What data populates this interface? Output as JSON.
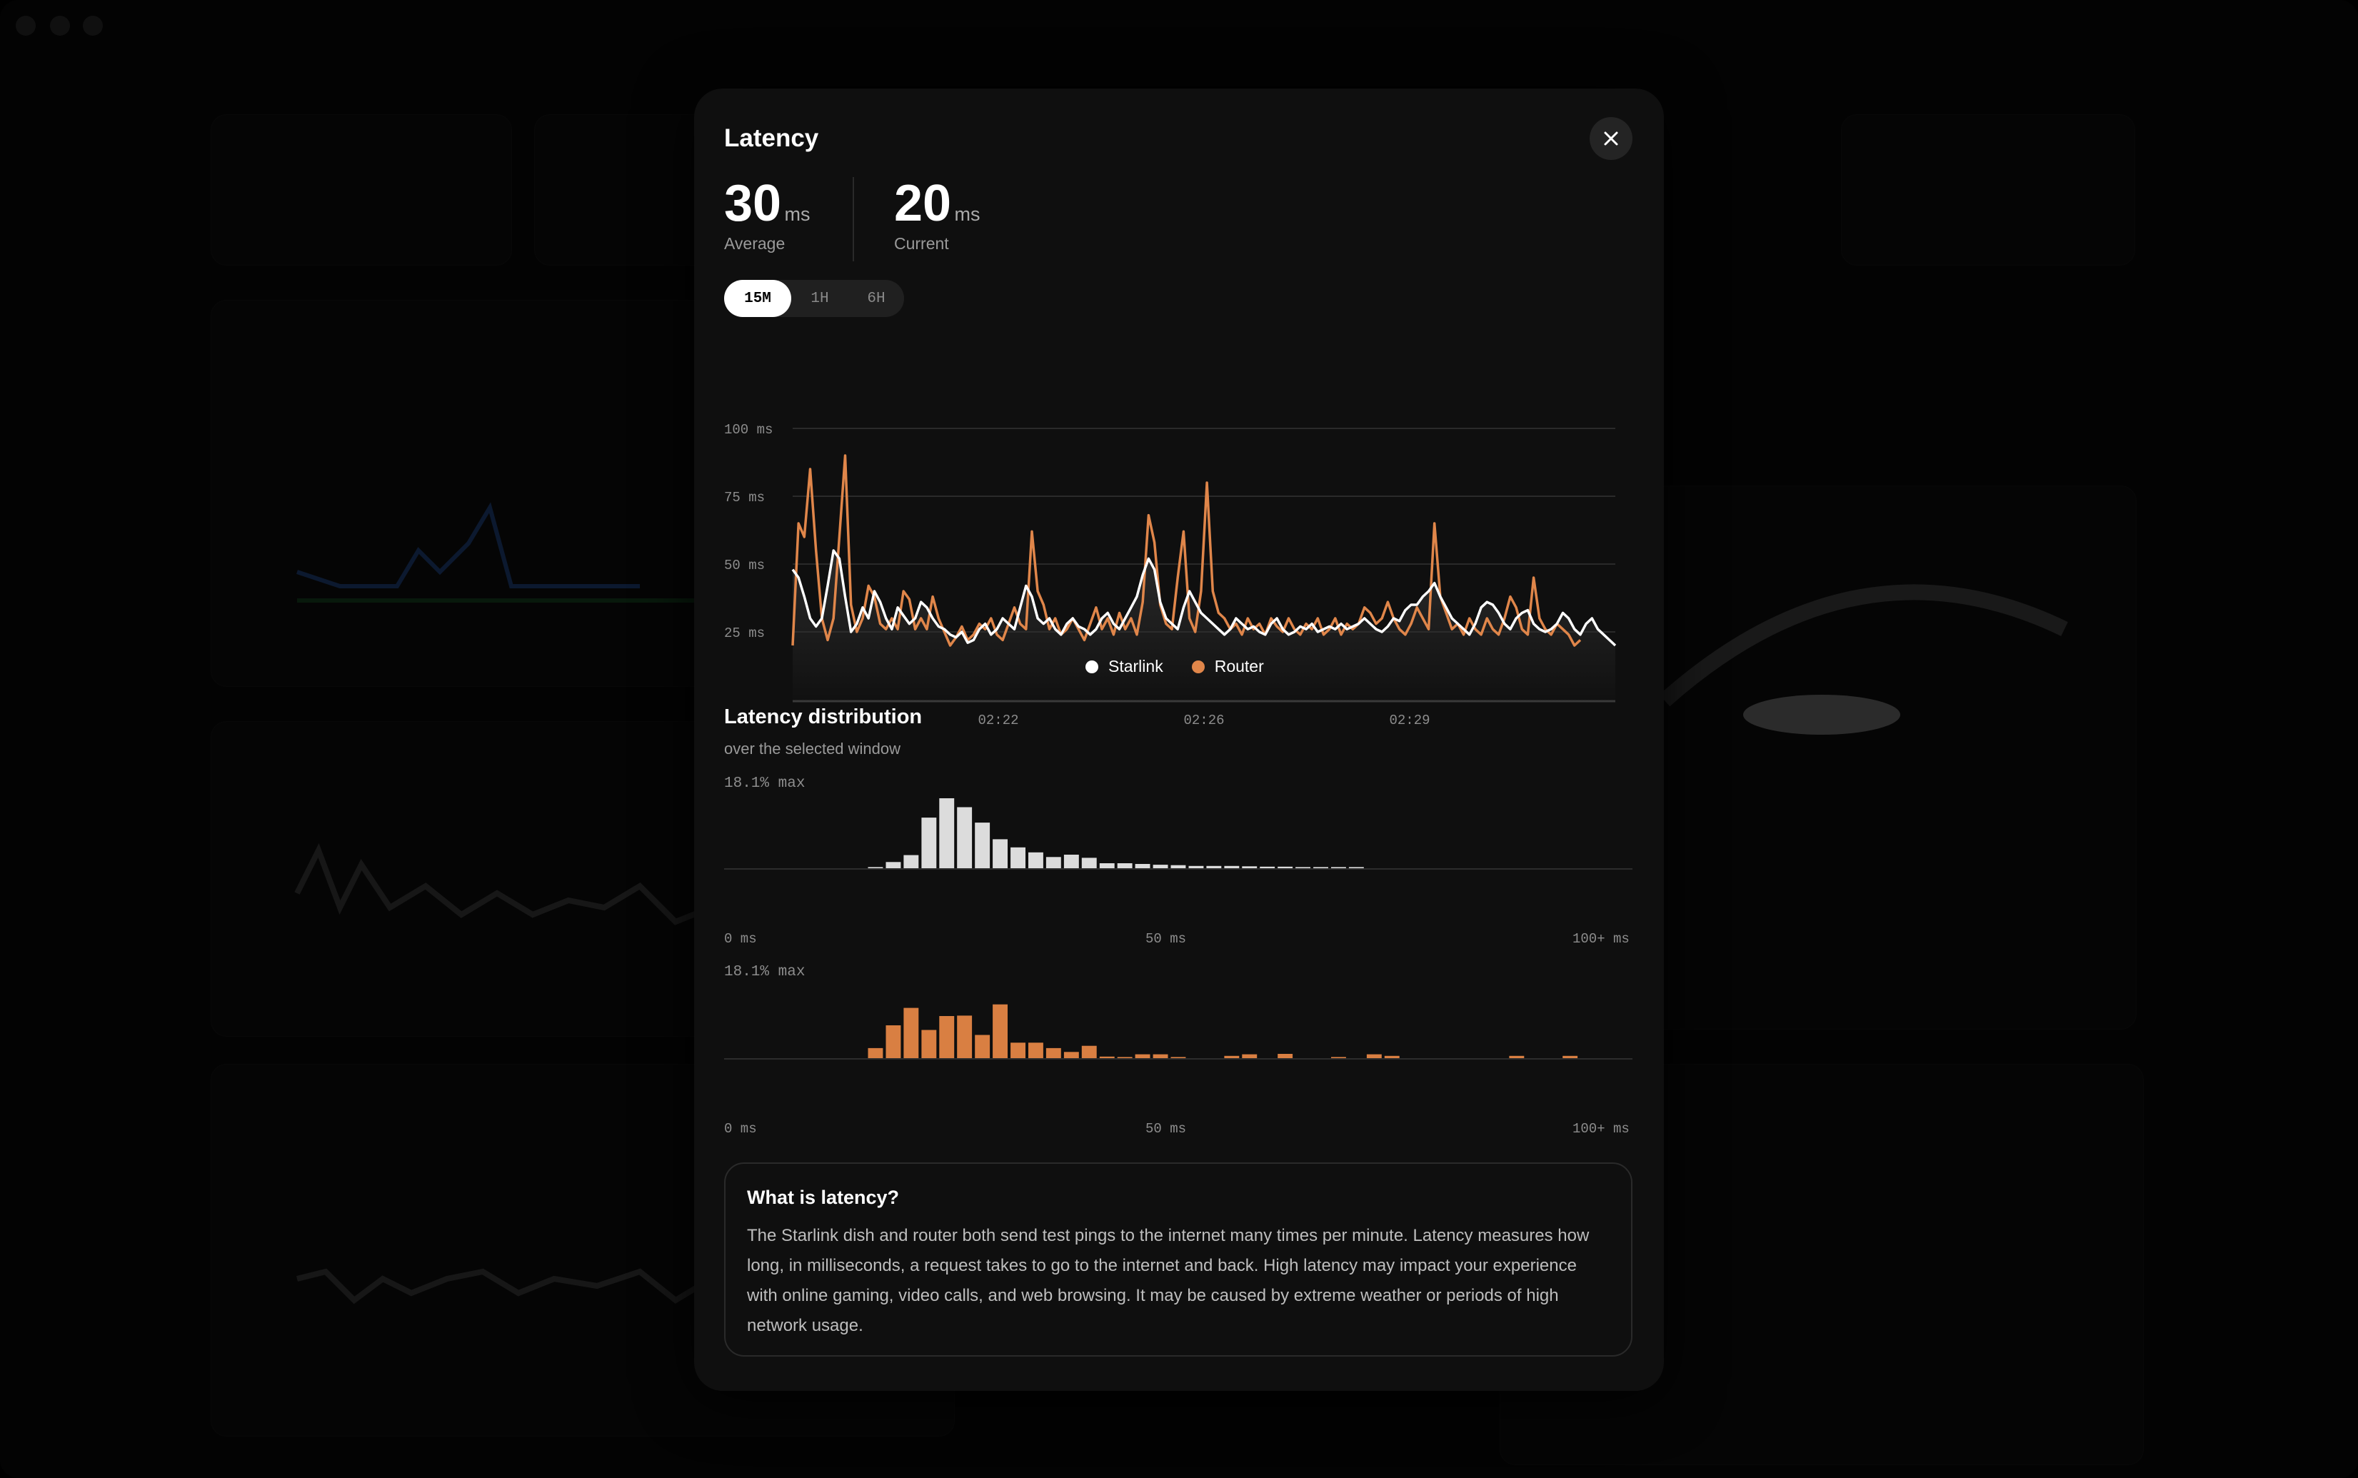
{
  "modal": {
    "title": "Latency",
    "average": {
      "value": "30",
      "unit": "ms",
      "label": "Average"
    },
    "current": {
      "value": "20",
      "unit": "ms",
      "label": "Current"
    },
    "ranges": [
      "15M",
      "1H",
      "6H"
    ],
    "selected_range": "15M",
    "legend": {
      "starlink": "Starlink",
      "router": "Router"
    },
    "colors": {
      "starlink": "#ffffff",
      "router": "#e0864a",
      "bars_starlink": "#dcdcdc",
      "bars_router": "#d97f42"
    },
    "distribution": {
      "title": "Latency distribution",
      "subtitle": "over the selected window",
      "max_label": "18.1% max",
      "axis": {
        "min": "0 ms",
        "mid": "50 ms",
        "max": "100+ ms"
      }
    },
    "info": {
      "title": "What is latency?",
      "text": "The Starlink dish and router both send test pings to the internet many times per minute. Latency measures how long, in milliseconds, a request takes to go to the internet and back. High latency may impact your experience with online gaming, video calls, and web browsing. It may be caused by extreme weather or periods of high network usage."
    }
  },
  "chart_data": [
    {
      "type": "line",
      "title": "",
      "ylabel": "",
      "ylim": [
        0,
        100
      ],
      "y_ticks": [
        "100 ms",
        "75 ms",
        "50 ms",
        "25 ms"
      ],
      "x_ticks": [
        "02:22",
        "02:26",
        "02:29"
      ],
      "series": [
        {
          "name": "Starlink",
          "values": [
            48,
            45,
            38,
            30,
            27,
            30,
            42,
            55,
            52,
            38,
            25,
            28,
            34,
            30,
            40,
            36,
            30,
            26,
            34,
            31,
            28,
            30,
            36,
            34,
            30,
            27,
            26,
            24,
            23,
            25,
            21,
            22,
            26,
            28,
            24,
            26,
            30,
            28,
            26,
            34,
            42,
            38,
            30,
            28,
            30,
            26,
            24,
            28,
            30,
            27,
            26,
            24,
            26,
            30,
            32,
            28,
            26,
            30,
            34,
            38,
            46,
            52,
            48,
            36,
            30,
            28,
            26,
            34,
            40,
            36,
            32,
            30,
            28,
            26,
            24,
            26,
            30,
            28,
            26,
            27,
            25,
            24,
            28,
            30,
            26,
            24,
            25,
            27,
            26,
            28,
            25,
            26,
            27,
            26,
            28,
            26,
            27,
            28,
            30,
            28,
            26,
            25,
            27,
            30,
            29,
            33,
            35,
            35,
            38,
            40,
            43,
            38,
            34,
            30,
            28,
            26,
            24,
            28,
            34,
            36,
            35,
            32,
            28,
            26,
            30,
            32,
            33,
            28,
            26,
            25,
            26,
            28,
            32,
            30,
            26,
            24,
            28,
            30,
            26,
            24,
            22,
            20
          ]
        },
        {
          "name": "Router",
          "values": [
            20,
            65,
            60,
            85,
            55,
            30,
            22,
            30,
            60,
            90,
            35,
            25,
            30,
            42,
            38,
            28,
            26,
            30,
            26,
            40,
            37,
            26,
            30,
            26,
            38,
            30,
            25,
            20,
            23,
            27,
            22,
            24,
            28,
            26,
            30,
            24,
            22,
            28,
            34,
            28,
            26,
            62,
            40,
            35,
            26,
            30,
            24,
            26,
            30,
            26,
            22,
            28,
            34,
            26,
            30,
            24,
            32,
            26,
            30,
            24,
            36,
            68,
            58,
            35,
            28,
            26,
            45,
            62,
            30,
            25,
            40,
            80,
            40,
            32,
            30,
            26,
            28,
            24,
            30,
            26,
            28,
            24,
            30,
            27,
            25,
            30,
            26,
            24,
            28,
            26,
            30,
            24,
            26,
            30,
            24,
            28,
            26,
            28,
            34,
            32,
            28,
            30,
            36,
            30,
            26,
            24,
            28,
            34,
            30,
            26,
            65,
            38,
            32,
            26,
            28,
            24,
            30,
            26,
            24,
            30,
            26,
            24,
            30,
            38,
            34,
            26,
            24,
            45,
            30,
            26,
            24,
            28,
            26,
            24,
            20,
            22
          ]
        }
      ]
    },
    {
      "type": "bar",
      "title": "Latency distribution",
      "series_name": "Starlink",
      "xlabel": "",
      "x_range": [
        "0 ms",
        "100+ ms"
      ],
      "ylim": [
        0,
        18.1
      ],
      "values": [
        0,
        0,
        0,
        0,
        0,
        0,
        0,
        0,
        0.3,
        1.6,
        3.4,
        13.1,
        18.1,
        15.8,
        11.8,
        7.5,
        5.4,
        4.1,
        2.9,
        3.5,
        2.7,
        1.3,
        1.3,
        1.1,
        0.9,
        0.8,
        0.6,
        0.6,
        0.6,
        0.5,
        0.4,
        0.4,
        0.3,
        0.3,
        0.3,
        0.3,
        0,
        0,
        0,
        0,
        0,
        0,
        0,
        0,
        0,
        0,
        0,
        0,
        0,
        0,
        0
      ]
    },
    {
      "type": "bar",
      "title": "",
      "series_name": "Router",
      "xlabel": "",
      "x_range": [
        "0 ms",
        "100+ ms"
      ],
      "ylim": [
        0,
        18.1
      ],
      "values": [
        0,
        0,
        0,
        0,
        0,
        0,
        0,
        0,
        2.6,
        8.5,
        13.0,
        7.3,
        10.9,
        11.0,
        6.0,
        13.9,
        4.0,
        4.0,
        2.6,
        1.6,
        3.2,
        0.4,
        0.3,
        1.0,
        1.0,
        0.3,
        0,
        0,
        0.6,
        1.0,
        0,
        1.1,
        0,
        0,
        0.3,
        0,
        1.0,
        0.6,
        0,
        0,
        0,
        0,
        0,
        0,
        0.6,
        0,
        0,
        0.6,
        0,
        0,
        0
      ]
    }
  ]
}
